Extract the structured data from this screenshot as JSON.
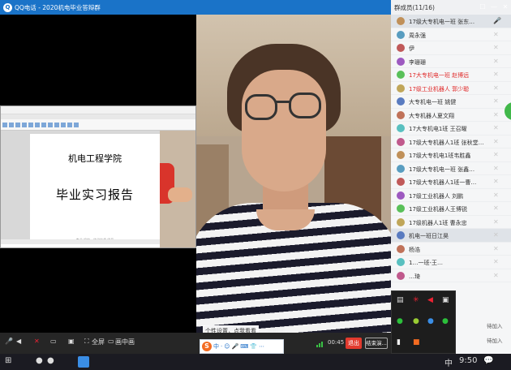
{
  "window": {
    "logo": "Q",
    "title": "QQ电话 - 2020机电毕业答辩群",
    "controls": [
      "☐",
      "—",
      "✕"
    ]
  },
  "shared_screen": {
    "doc_title_1": "机电工程学院",
    "doc_title_2": "毕业实习报告",
    "doc_footer": "专业 机电一体化技术 学号"
  },
  "subtitle": {
    "hint": "个性设置，点我看看",
    "caption": "…的时间 …"
  },
  "ime": {
    "logo": "S",
    "items": [
      "中",
      "·",
      "☺",
      "🎤",
      "⌨",
      "👕",
      "⋯"
    ]
  },
  "bottom_bar": {
    "mic": "🎤",
    "speaker": "◀",
    "camera": "✕",
    "share": "▭",
    "screen": "▣",
    "fullscreen_icon": "⛶",
    "fullscreen_label": "全屏",
    "pip_icon": "▭",
    "pip_label": "画中画",
    "duration": "00:45",
    "exit_label": "退出",
    "end_share_label": "结束演..."
  },
  "members_panel": {
    "title": "群成员(11/16)",
    "members": [
      {
        "name": "17级大专机电一班   张东…",
        "red": false,
        "mic": "🎤"
      },
      {
        "name": "周永强",
        "red": false,
        "mic": "✕"
      },
      {
        "name": "伊",
        "red": false,
        "mic": "✕"
      },
      {
        "name": "李珊珊",
        "red": false,
        "mic": "✕"
      },
      {
        "name": "17大专机电一班   赵博远",
        "red": true,
        "mic": "✕"
      },
      {
        "name": "17级工业机器人   郭少聪",
        "red": true,
        "mic": "✕"
      },
      {
        "name": "大专机电一班   姚健",
        "red": false,
        "mic": "✕"
      },
      {
        "name": "大专机器人夏文翔",
        "red": false,
        "mic": "✕"
      },
      {
        "name": "17大专机电1班   王召曜",
        "red": false,
        "mic": "✕"
      },
      {
        "name": "17级大专机器人1班   张秋堂…",
        "red": false,
        "mic": "✕"
      },
      {
        "name": "17级大专机电1班韦胜鑫",
        "red": false,
        "mic": "✕"
      },
      {
        "name": "17级大专机电一班   张鑫…",
        "red": false,
        "mic": "✕"
      },
      {
        "name": "17级大专机器人1班一曹…",
        "red": false,
        "mic": "✕"
      },
      {
        "name": "17级工业机器人   刘鹏",
        "red": false,
        "mic": "✕"
      },
      {
        "name": "17级工业机器人王博锐",
        "red": false,
        "mic": "✕"
      },
      {
        "name": "17级机器人1班   曹永忠",
        "red": false,
        "mic": "✕"
      },
      {
        "name": "机电一班日江昊",
        "red": false,
        "mic": "✕"
      },
      {
        "name": "杨浩",
        "red": false,
        "mic": "✕"
      },
      {
        "name": "1…一班-王…",
        "red": false,
        "mic": "✕"
      },
      {
        "name": "…琦",
        "red": false,
        "mic": "✕"
      }
    ],
    "pending": "待加入"
  },
  "taskbar": {
    "start": "⊞",
    "chrome": "●",
    "wechat": "●",
    "lang": "中",
    "time": "9:50",
    "notify": "💬"
  },
  "colors": {
    "titlebar": "#1a73c8",
    "exit": "#e23a2e",
    "member_highlight": "#e02a2a",
    "mic_on": "#3ab54a"
  }
}
